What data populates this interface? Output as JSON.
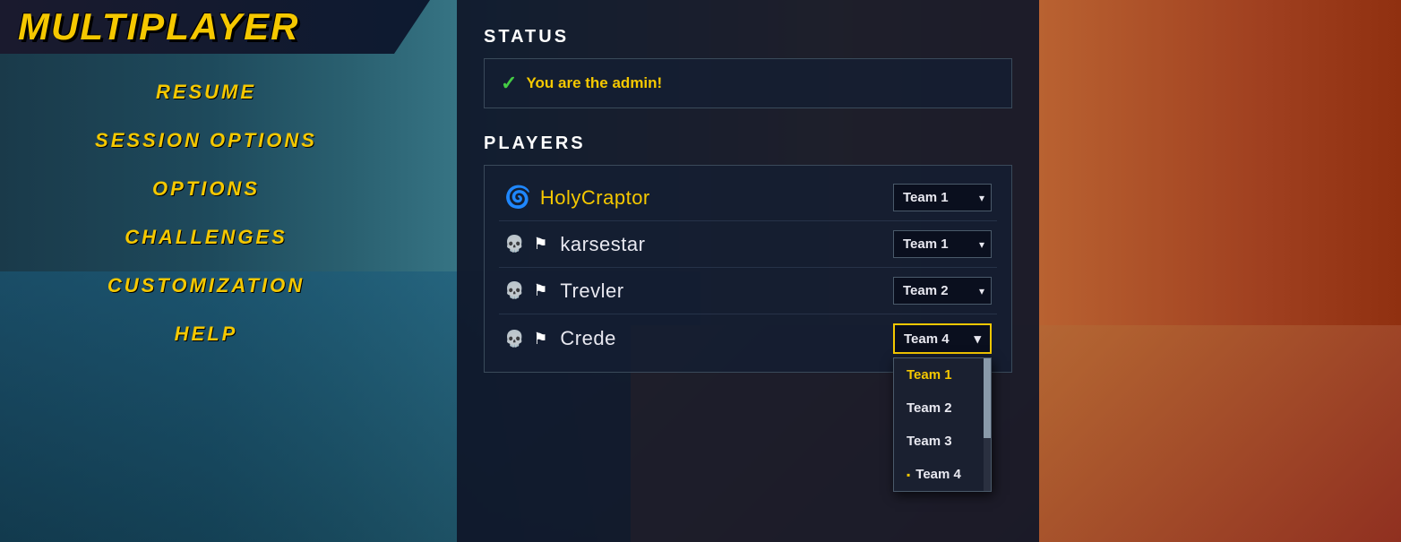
{
  "banner": {
    "title": "MULTIPLAYER"
  },
  "nav": {
    "items": [
      {
        "label": "RESUME",
        "id": "resume"
      },
      {
        "label": "SESSION OPTIONS",
        "id": "session-options"
      },
      {
        "label": "OPTIONS",
        "id": "options"
      },
      {
        "label": "CHALLENGES",
        "id": "challenges"
      },
      {
        "label": "CUSTOMIZATION",
        "id": "customization"
      },
      {
        "label": "HELP",
        "id": "help"
      }
    ]
  },
  "status_section": {
    "title": "STATUS",
    "message": "You are the admin!"
  },
  "players_section": {
    "title": "PLAYERS",
    "players": [
      {
        "name": "HolyCraptor",
        "emblem": "🐉",
        "is_admin": true,
        "team": "Team 1",
        "skull": false,
        "flag": false
      },
      {
        "name": "karsestar",
        "emblem": "",
        "is_admin": false,
        "team": "Team 1",
        "skull": true,
        "flag": true
      },
      {
        "name": "Trevler",
        "emblem": "",
        "is_admin": false,
        "team": "Team 2",
        "skull": true,
        "flag": true
      },
      {
        "name": "Crede",
        "emblem": "",
        "is_admin": false,
        "team": "Team 4",
        "skull": true,
        "flag": true,
        "dropdown_open": true
      }
    ],
    "team_options": [
      "Team 1",
      "Team 2",
      "Team 3",
      "Team 4"
    ]
  },
  "dropdown": {
    "team1": "Team 1",
    "team2": "Team 2",
    "team3": "Team 3",
    "team4": "Team 4"
  },
  "icons": {
    "skull": "💀",
    "flag": "⚑",
    "check": "✓",
    "arrow_down": "▾"
  }
}
